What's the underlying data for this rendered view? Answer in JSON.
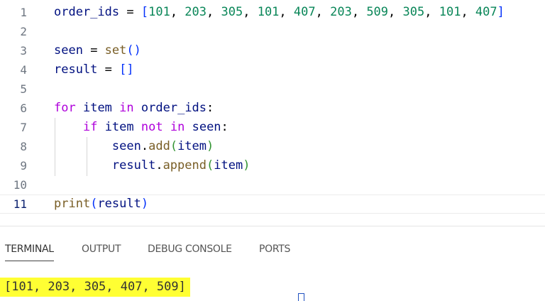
{
  "editor": {
    "current_line": "11",
    "lines": [
      {
        "number": "1",
        "tokens": [
          {
            "t": "order_ids",
            "c": "var"
          },
          {
            "t": " = ",
            "c": "op"
          },
          {
            "t": "[",
            "c": "br"
          },
          {
            "t": "101",
            "c": "num"
          },
          {
            "t": ", ",
            "c": "pl"
          },
          {
            "t": "203",
            "c": "num"
          },
          {
            "t": ", ",
            "c": "pl"
          },
          {
            "t": "305",
            "c": "num"
          },
          {
            "t": ", ",
            "c": "pl"
          },
          {
            "t": "101",
            "c": "num"
          },
          {
            "t": ", ",
            "c": "pl"
          },
          {
            "t": "407",
            "c": "num"
          },
          {
            "t": ", ",
            "c": "pl"
          },
          {
            "t": "203",
            "c": "num"
          },
          {
            "t": ", ",
            "c": "pl"
          },
          {
            "t": "509",
            "c": "num"
          },
          {
            "t": ", ",
            "c": "pl"
          },
          {
            "t": "305",
            "c": "num"
          },
          {
            "t": ", ",
            "c": "pl"
          },
          {
            "t": "101",
            "c": "num"
          },
          {
            "t": ", ",
            "c": "pl"
          },
          {
            "t": "407",
            "c": "num"
          },
          {
            "t": "]",
            "c": "br"
          }
        ]
      },
      {
        "number": "2",
        "tokens": []
      },
      {
        "number": "3",
        "tokens": [
          {
            "t": "seen",
            "c": "var"
          },
          {
            "t": " = ",
            "c": "op"
          },
          {
            "t": "set",
            "c": "fn"
          },
          {
            "t": "()",
            "c": "br"
          }
        ]
      },
      {
        "number": "4",
        "tokens": [
          {
            "t": "result",
            "c": "var"
          },
          {
            "t": " = ",
            "c": "op"
          },
          {
            "t": "[]",
            "c": "br"
          }
        ]
      },
      {
        "number": "5",
        "tokens": []
      },
      {
        "number": "6",
        "tokens": [
          {
            "t": "for",
            "c": "kw"
          },
          {
            "t": " ",
            "c": "pl"
          },
          {
            "t": "item",
            "c": "var"
          },
          {
            "t": " ",
            "c": "pl"
          },
          {
            "t": "in",
            "c": "kw"
          },
          {
            "t": " ",
            "c": "pl"
          },
          {
            "t": "order_ids",
            "c": "var"
          },
          {
            "t": ":",
            "c": "pl"
          }
        ]
      },
      {
        "number": "7",
        "tokens": [
          {
            "t": "    ",
            "c": "pl"
          },
          {
            "t": "if",
            "c": "kw"
          },
          {
            "t": " ",
            "c": "pl"
          },
          {
            "t": "item",
            "c": "var"
          },
          {
            "t": " ",
            "c": "pl"
          },
          {
            "t": "not",
            "c": "kw"
          },
          {
            "t": " ",
            "c": "pl"
          },
          {
            "t": "in",
            "c": "kw"
          },
          {
            "t": " ",
            "c": "pl"
          },
          {
            "t": "seen",
            "c": "var"
          },
          {
            "t": ":",
            "c": "pl"
          }
        ]
      },
      {
        "number": "8",
        "tokens": [
          {
            "t": "        ",
            "c": "pl"
          },
          {
            "t": "seen",
            "c": "var"
          },
          {
            "t": ".",
            "c": "pl"
          },
          {
            "t": "add",
            "c": "fn"
          },
          {
            "t": "(",
            "c": "br2"
          },
          {
            "t": "item",
            "c": "var"
          },
          {
            "t": ")",
            "c": "br2"
          }
        ]
      },
      {
        "number": "9",
        "tokens": [
          {
            "t": "        ",
            "c": "pl"
          },
          {
            "t": "result",
            "c": "var"
          },
          {
            "t": ".",
            "c": "pl"
          },
          {
            "t": "append",
            "c": "fn"
          },
          {
            "t": "(",
            "c": "br2"
          },
          {
            "t": "item",
            "c": "var"
          },
          {
            "t": ")",
            "c": "br2"
          }
        ]
      },
      {
        "number": "10",
        "tokens": []
      },
      {
        "number": "11",
        "tokens": [
          {
            "t": "print",
            "c": "fn"
          },
          {
            "t": "(",
            "c": "br"
          },
          {
            "t": "result",
            "c": "var"
          },
          {
            "t": ")",
            "c": "br"
          }
        ]
      }
    ]
  },
  "panel": {
    "tabs": [
      {
        "id": "terminal",
        "label": "TERMINAL",
        "active": true
      },
      {
        "id": "output",
        "label": "OUTPUT",
        "active": false
      },
      {
        "id": "debug-console",
        "label": "DEBUG CONSOLE",
        "active": false
      },
      {
        "id": "ports",
        "label": "PORTS",
        "active": false
      }
    ],
    "terminal_output": "[101, 203, 305, 407, 509]",
    "highlight_color": "#ffff33"
  },
  "colors": {
    "keyword": "#af00db",
    "variable": "#001080",
    "number": "#098658",
    "function": "#795e26",
    "bracket": "#0431fa"
  }
}
